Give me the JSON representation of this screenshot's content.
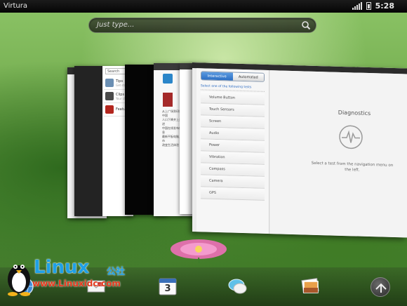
{
  "status_bar": {
    "app_name": "Virtura",
    "time": "5:28"
  },
  "search": {
    "placeholder": "Just type..."
  },
  "cards": {
    "email_list": {
      "search_label": "Search",
      "items": [
        {
          "title": "Tips",
          "subtitle": "Get started"
        },
        {
          "title": "Clips",
          "subtitle": "Your clips"
        },
        {
          "title": "Featured",
          "subtitle": ""
        }
      ]
    },
    "cn_lines": [
      "从上广场到印尼中国",
      "人口下降并上升进",
      "中国在线发布信息",
      "最新平板电脑上市",
      "改变生活体验"
    ]
  },
  "diagnostics": {
    "tabs": [
      "Interactive",
      "Automated"
    ],
    "select_label": "Select one of the following tests",
    "tests": [
      "Volume Button",
      "Touch Sensors",
      "Screen",
      "Audio",
      "Power",
      "Vibration",
      "Compass",
      "Camera",
      "GPS"
    ],
    "title": "Diagnostics",
    "message": "Select a test from the navigation menu on the left."
  },
  "dock": {
    "items": [
      "email",
      "calendar",
      "messaging",
      "photos"
    ],
    "calendar_day": "3"
  },
  "watermark": {
    "brand": "Linux",
    "brand_cn": "公社",
    "url": "www.Linuxidc.com"
  },
  "colors": {
    "accent": "#2c6fc4",
    "watermark_blue": "#1fa0e6",
    "watermark_red": "#e63a1e"
  }
}
